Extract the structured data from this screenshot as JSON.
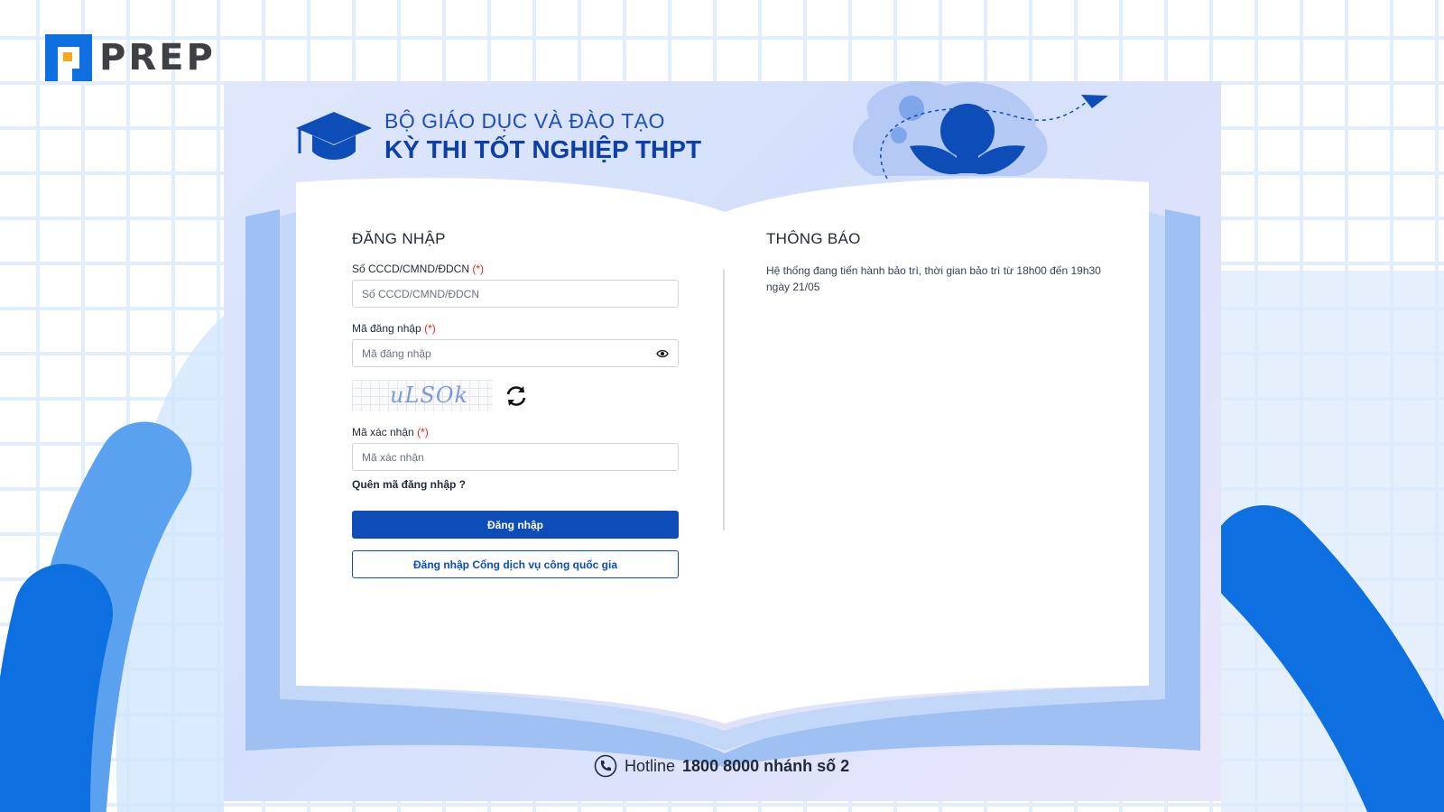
{
  "brand": {
    "name": "PREP",
    "logo_icon": "prep-logo-icon"
  },
  "header": {
    "ministry": "BỘ GIÁO DỤC VÀ ĐÀO TẠO",
    "exam": "KỲ THI TỐT NGHIỆP THPT"
  },
  "login": {
    "title": "ĐĂNG NHẬP",
    "id_label": "Số CCCD/CMND/ĐDCN",
    "id_placeholder": "Số CCCD/CMND/ĐDCN",
    "code_label": "Mã đăng nhập",
    "code_placeholder": "Mã đăng nhập",
    "required_mark": "(*)",
    "captcha_text": "uLSOk",
    "verify_label": "Mã xác nhận",
    "verify_placeholder": "Mã xác nhận",
    "forgot_link": "Quên mã đăng nhập ?",
    "submit_label": "Đăng nhập",
    "national_portal_label": "Đăng nhập Cổng dịch vụ công quốc gia"
  },
  "notice": {
    "title": "THÔNG BÁO",
    "text": "Hệ thống đang tiến hành bảo trì, thời gian bảo trì từ 18h00 đến 19h30 ngày 21/05"
  },
  "footer": {
    "hotline_prefix": "Hotline",
    "hotline_number": "1800 8000 nhánh số 2"
  },
  "colors": {
    "primary": "#0d4db8",
    "accent": "#0d3fa8",
    "required": "#dc2626"
  }
}
